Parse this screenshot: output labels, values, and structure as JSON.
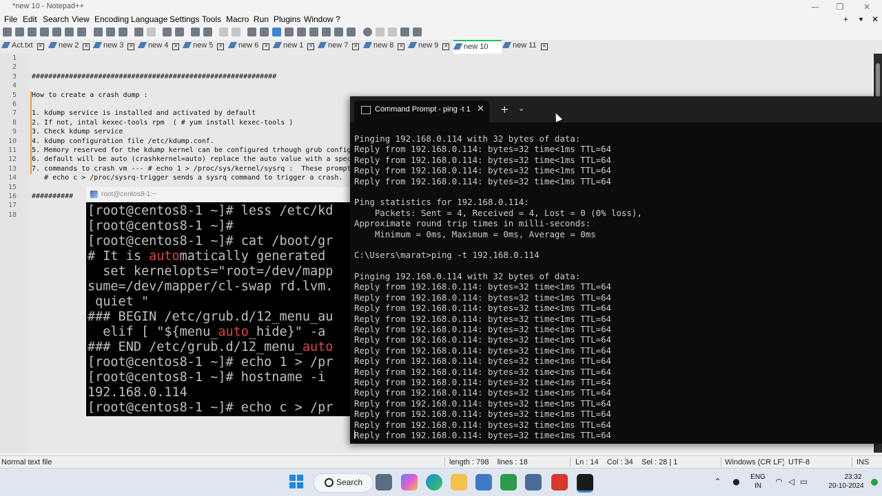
{
  "window": {
    "title": "*new 10 - Notepad++",
    "controls": [
      "—",
      "❐",
      "✕"
    ]
  },
  "menu": [
    "File",
    "Edit",
    "Search",
    "View",
    "Encoding",
    "Language",
    "Settings",
    "Tools",
    "Macro",
    "Run",
    "Plugins",
    "Window",
    "?"
  ],
  "menu_right": [
    "+",
    "▼",
    "✕"
  ],
  "tabs": [
    {
      "label": "Act.txt",
      "active": false
    },
    {
      "label": "new 2",
      "active": false
    },
    {
      "label": "new 3",
      "active": false
    },
    {
      "label": "new 4",
      "active": false
    },
    {
      "label": "new 5",
      "active": false
    },
    {
      "label": "new 6",
      "active": false
    },
    {
      "label": "new 1",
      "active": false
    },
    {
      "label": "new 7",
      "active": false
    },
    {
      "label": "new 8",
      "active": false
    },
    {
      "label": "new 9",
      "active": false
    },
    {
      "label": "new 10",
      "active": true
    },
    {
      "label": "new 11",
      "active": false
    }
  ],
  "editor": {
    "line_numbers": [
      "1",
      "2",
      "3",
      "4",
      "5",
      "6",
      "7",
      "8",
      "9",
      "10",
      "11",
      "12",
      "13",
      "14",
      "15",
      "16",
      "17",
      "18"
    ],
    "lines": [
      "",
      "",
      "###########################################################",
      "",
      "How to create a crash dump :",
      "",
      "1. kdump service is installed and activated by default",
      "2. If not, intal kexec-tools rpm  ( # yum install kexec-tools )",
      "3. Check kdump service",
      "4. kdump configuration file /etc/kdump.conf.",
      "5. Memory reserved for the kdump kernel can be configured trhough grub config",
      "6. default will be auto (crashkernel=auto) replace the auto value with a spec",
      "7. commands to crash vm --- # echo 1 > /proc/sys/kernel/sysrq :  These prompt",
      "   # echo c > /proc/sysrq-trigger sends a sysrq command to trigger a crash.",
      "",
      "##########",
      "",
      ""
    ]
  },
  "status": {
    "file_type": "Normal text file",
    "length": "length : 798    lines : 18",
    "position": "Ln : 14    Col : 34    Sel : 28 | 1",
    "eol": "Windows (CR LF)",
    "encoding": "UTF-8",
    "mode": "INS"
  },
  "cmd": {
    "tab_title": "Command Prompt - ping  -t 1",
    "close": "✕",
    "new_tab": "+",
    "dropdown": "⌄",
    "output": [
      "Pinging 192.168.0.114 with 32 bytes of data:",
      "Reply from 192.168.0.114: bytes=32 time<1ms TTL=64",
      "Reply from 192.168.0.114: bytes=32 time<1ms TTL=64",
      "Reply from 192.168.0.114: bytes=32 time<1ms TTL=64",
      "Reply from 192.168.0.114: bytes=32 time<1ms TTL=64",
      "",
      "Ping statistics for 192.168.0.114:",
      "    Packets: Sent = 4, Received = 4, Lost = 0 (0% loss),",
      "Approximate round trip times in milli-seconds:",
      "    Minimum = 0ms, Maximum = 0ms, Average = 0ms",
      "",
      "C:\\Users\\marat>ping -t 192.168.0.114",
      "",
      "Pinging 192.168.0.114 with 32 bytes of data:",
      "Reply from 192.168.0.114: bytes=32 time<1ms TTL=64",
      "Reply from 192.168.0.114: bytes=32 time<1ms TTL=64",
      "Reply from 192.168.0.114: bytes=32 time<1ms TTL=64",
      "Reply from 192.168.0.114: bytes=32 time<1ms TTL=64",
      "Reply from 192.168.0.114: bytes=32 time<1ms TTL=64",
      "Reply from 192.168.0.114: bytes=32 time<1ms TTL=64",
      "Reply from 192.168.0.114: bytes=32 time<1ms TTL=64",
      "Reply from 192.168.0.114: bytes=32 time<1ms TTL=64",
      "Reply from 192.168.0.114: bytes=32 time<1ms TTL=64",
      "Reply from 192.168.0.114: bytes=32 time<1ms TTL=64",
      "Reply from 192.168.0.114: bytes=32 time<1ms TTL=64",
      "Reply from 192.168.0.114: bytes=32 time<1ms TTL=64",
      "Reply from 192.168.0.114: bytes=32 time<1ms TTL=64",
      "Reply from 192.168.0.114: bytes=32 time<1ms TTL=64",
      "Reply from 192.168.0.114: bytes=32 time<1ms TTL=64"
    ]
  },
  "putty": {
    "title": "root@centos8-1:~",
    "lines": [
      "[root@centos8-1 ~]# less /etc/kd",
      "[root@centos8-1 ~]#",
      "[root@centos8-1 ~]# cat /boot/gr",
      "# It is automatically generated",
      "  set kernelopts=\"root=/dev/mapp",
      "sume=/dev/mapper/cl-swap rd.lvm.",
      " quiet \"",
      "### BEGIN /etc/grub.d/12_menu_au",
      "  elif [ \"${menu_auto_hide}\" -a",
      "### END /etc/grub.d/12_menu_auto",
      "[root@centos8-1 ~]# echo 1 > /pr",
      "[root@centos8-1 ~]# hostname -i",
      "192.168.0.114",
      "[root@centos8-1 ~]# echo c > /pr"
    ]
  },
  "taskbar": {
    "search_label": "Search",
    "lang_top": "ENG",
    "lang_bottom": "IN",
    "time": "23:32",
    "date": "20-10-2024"
  },
  "icons": {
    "colors": {
      "windows": "#1e88e5",
      "accent_tab": "#29b86a",
      "cmd_bg": "#0c0c0c",
      "putty_red": "#d44444"
    }
  }
}
